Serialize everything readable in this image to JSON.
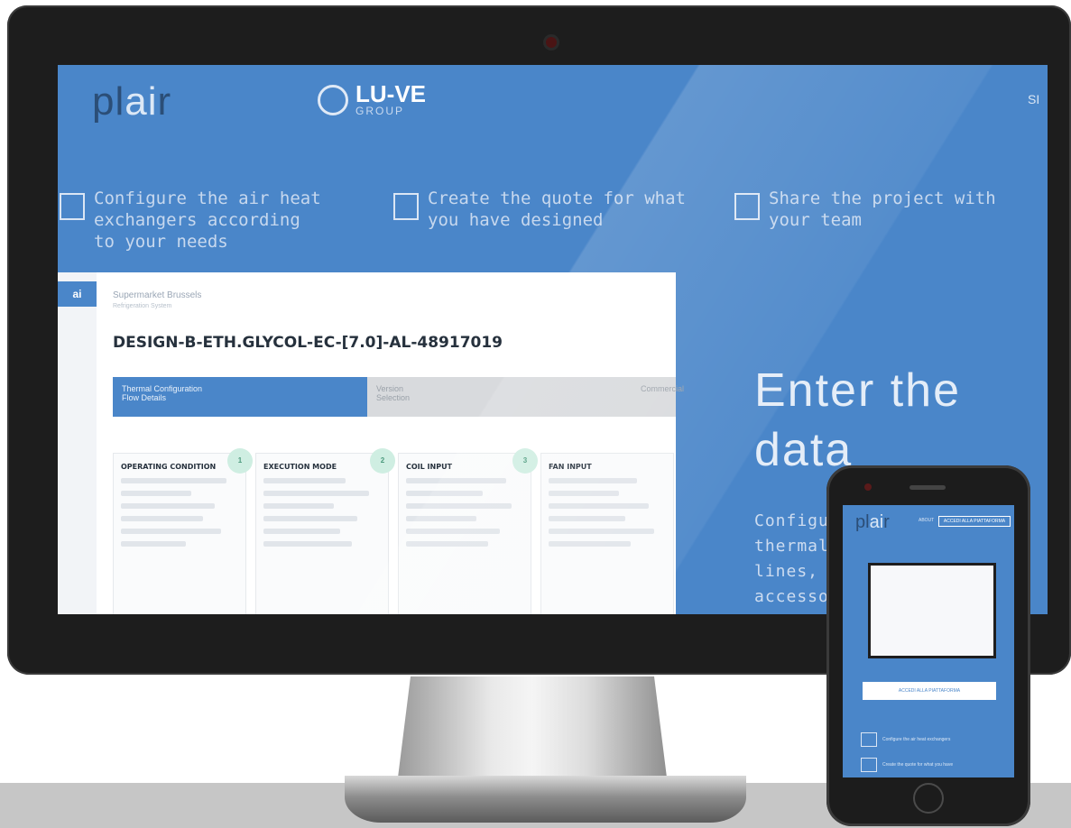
{
  "brand": {
    "logo_part1": "pl",
    "logo_part2": "ai",
    "logo_part3": "r",
    "partner_name": "LU-VE",
    "partner_sub": "GROUP"
  },
  "nav": {
    "signin_label": "SI"
  },
  "features": [
    {
      "text": "Configure the air heat exchangers according to your needs",
      "icon": "table-icon"
    },
    {
      "text": "Create the quote for what you have designed",
      "icon": "document-icon"
    },
    {
      "text": "Share the project with your team",
      "icon": "share-icon"
    }
  ],
  "hero": {
    "title_line1": "Enter the",
    "title_line2": "data",
    "subtitle_lines": [
      "Configu",
      "thermal",
      "lines, se",
      "accesso"
    ]
  },
  "app_preview": {
    "sidebar_tag": "ai",
    "breadcrumb": "Supermarket Brussels",
    "breadcrumb_sub": "Refrigeration System",
    "design_title": "DESIGN-B-ETH.GLYCOL-EC-[7.0]-AL-48917019",
    "steps": [
      {
        "label": "Thermal Configuration",
        "sub": "Flow Details"
      },
      {
        "label": "Version",
        "sub": "Selection"
      },
      {
        "label": "Commercial"
      }
    ],
    "cards": [
      {
        "title": "OPERATING CONDITION",
        "number": "1"
      },
      {
        "title": "EXECUTION MODE",
        "number": "2"
      },
      {
        "title": "COIL INPUT",
        "number": "3"
      },
      {
        "title": "FAN INPUT",
        "number": ""
      }
    ]
  },
  "phone": {
    "nav_label": "ABOUT",
    "top_button": "ACCEDI ALLA PIATTAFORMA",
    "cta": "ACCEDI ALLA PIATTAFORMA",
    "feature1": "Configure the air heat exchangers",
    "feature2": "Create the quote for what you have"
  },
  "colors": {
    "screen_blue": "#4a86c9",
    "bezel": "#1d1d1d",
    "floor": "#c6c6c6"
  }
}
